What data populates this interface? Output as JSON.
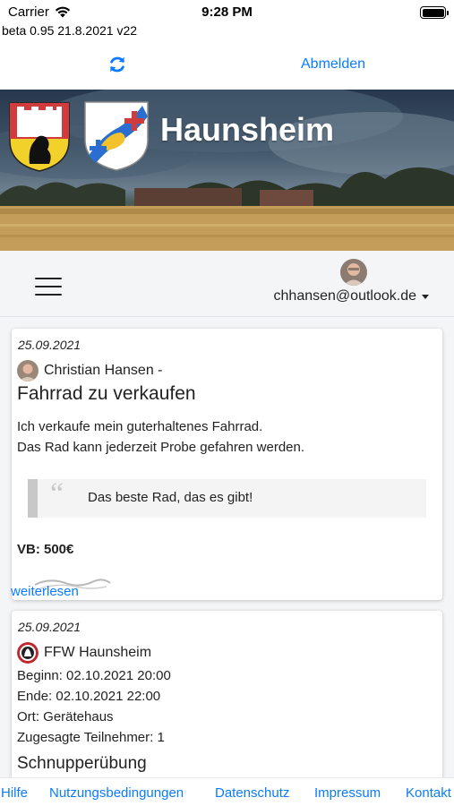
{
  "status_bar": {
    "carrier": "Carrier",
    "time": "9:28 PM",
    "wifi_icon": "wifi-icon",
    "battery_icon": "battery-icon"
  },
  "version_text": "beta 0.95 21.8.2021 v22",
  "topbar": {
    "refresh_icon": "refresh-icon",
    "logout_label": "Abmelden"
  },
  "banner": {
    "title": "Haunsheim",
    "accent_color": "#0a7bff"
  },
  "nav": {
    "menu_icon": "hamburger-icon",
    "user_email": "chhansen@outlook.de"
  },
  "posts": [
    {
      "date": "25.09.2021",
      "author": "Christian Hansen -",
      "title": "Fahrrad zu verkaufen",
      "body": [
        "Ich verkaufe mein guterhaltenes Fahrrad.",
        "Das Rad kann jederzeit Probe gefahren werden."
      ],
      "quote": "Das beste Rad, das es gibt!",
      "price": "VB: 500€",
      "read_more": "weiterlesen"
    },
    {
      "date": "25.09.2021",
      "author": "FFW Haunsheim",
      "lines": [
        "Beginn: 02.10.2021 20:00",
        "Ende: 02.10.2021 22:00",
        "Ort: Gerätehaus",
        "Zugesagte Teilnehmer: 1"
      ],
      "title": "Schnupperübung"
    }
  ],
  "footer": {
    "links": [
      "Hilfe",
      "Nutzungsbedingungen",
      "Datenschutz",
      "Impressum",
      "Kontakt"
    ]
  }
}
